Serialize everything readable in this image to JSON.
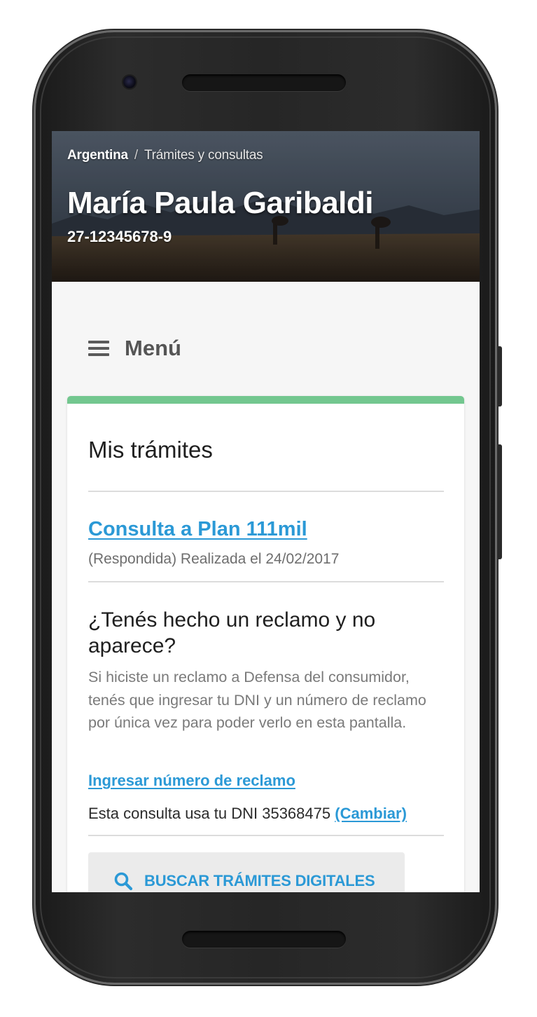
{
  "header": {
    "breadcrumb_home": "Argentina",
    "breadcrumb_separator": "/",
    "breadcrumb_current": "Trámites y consultas",
    "user_name": "María Paula Garibaldi",
    "user_cuil": "27-12345678-9"
  },
  "menu": {
    "icon": "hamburger-icon",
    "label": "Menú"
  },
  "card": {
    "accent_color": "#73c78f",
    "title": "Mis trámites",
    "tramite": {
      "link_label": "Consulta a Plan 111mil",
      "status": "(Respondida) Realizada el 24/02/2017"
    },
    "reclamo": {
      "question": "¿Tenés hecho un reclamo y no aparece?",
      "description": "Si hiciste un reclamo a Defensa del consumidor, tenés que ingresar tu DNI y un número de reclamo por única vez para poder verlo en esta pantalla.",
      "link_label": "Ingresar número de reclamo",
      "dni_text": "Esta consulta usa tu DNI 35368475",
      "change_label": "(Cambiar)"
    },
    "search_button": {
      "icon": "search-icon",
      "label": "BUSCAR TRÁMITES DIGITALES"
    }
  },
  "colors": {
    "link": "#2b99d6",
    "background": "#f6f6f6"
  }
}
